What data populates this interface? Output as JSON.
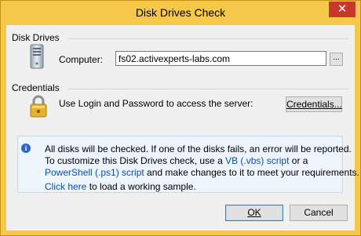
{
  "window": {
    "title": "Disk Drives Check",
    "close_glyph": "✕"
  },
  "disk_drives": {
    "group_label": "Disk Drives",
    "computer_label": "Computer:",
    "computer_value": "fs02.activexperts-labs.com",
    "browse_label": "..."
  },
  "credentials": {
    "group_label": "Credentials",
    "description": "Use Login and Password to access the server:",
    "button_label": "Credentials..."
  },
  "info": {
    "line1": "All disks will be checked. If one of the disks fails, an error will be reported.",
    "line2_prefix": "To customize this Disk Drives check, use a ",
    "line2_link": "VB (.vbs) script",
    "line2_suffix": " or a",
    "line3_link": "PowerShell (.ps1) script",
    "line3_suffix": " and make changes to it to meet your requirements.",
    "line4_link": "Click here",
    "line4_suffix": " to load a working sample."
  },
  "footer": {
    "ok_label": "OK",
    "cancel_label": "Cancel"
  },
  "colors": {
    "titlebar": "#f6c84a",
    "close_button": "#c7372a",
    "link": "#0a4fa8",
    "info_background": "#eef4fb"
  },
  "icons": {
    "server": "server-icon",
    "lock": "lock-icon",
    "info": "info-icon"
  }
}
